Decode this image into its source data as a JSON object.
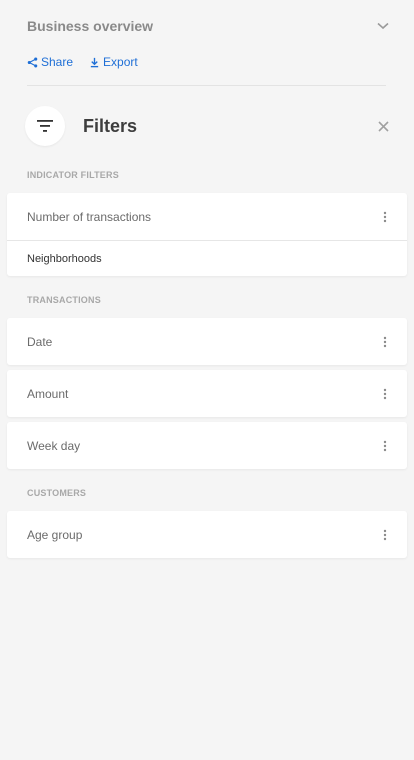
{
  "header": {
    "title": "Business overview",
    "collapse_icon": "chevron-down-icon"
  },
  "actions": {
    "share_label": "Share",
    "share_icon": "share-icon",
    "export_label": "Export",
    "export_icon": "download-icon"
  },
  "filters": {
    "title": "Filters",
    "icon": "filter-list-icon",
    "close_icon": "close-icon"
  },
  "sections": [
    {
      "label": "INDICATOR FILTERS",
      "items": [
        {
          "label": "Number of transactions",
          "sub": "Neighborhoods"
        }
      ]
    },
    {
      "label": "TRANSACTIONS",
      "items": [
        {
          "label": "Date"
        },
        {
          "label": "Amount"
        },
        {
          "label": "Week day"
        }
      ]
    },
    {
      "label": "CUSTOMERS",
      "items": [
        {
          "label": "Age group"
        }
      ]
    }
  ],
  "colors": {
    "accent": "#1f6fd6",
    "background": "#f5f5f5",
    "card": "#ffffff"
  }
}
